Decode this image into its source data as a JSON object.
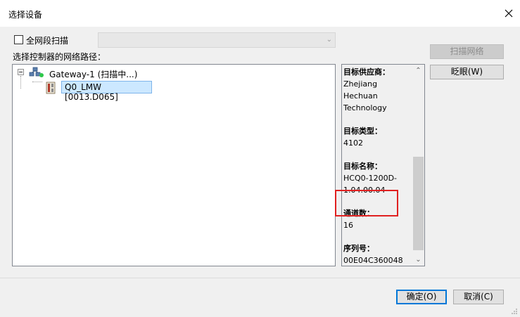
{
  "window": {
    "title": "选择设备"
  },
  "scan_all": {
    "label": "全网段扫描",
    "checked": false
  },
  "combo": {
    "value": ""
  },
  "path_label": "选择控制器的网络路径：",
  "tree": {
    "gateway": {
      "label": "Gateway-1 (扫描中...)",
      "icon": "gateway-network-icon"
    },
    "device": {
      "label": "Q0_LMW [0013.D065]",
      "icon": "plc-device-icon"
    }
  },
  "info": [
    {
      "heading": "目标供应商：",
      "value": "Zhejiang Hechuan Technology"
    },
    {
      "heading": "目标类型：",
      "value": "4102"
    },
    {
      "heading": "目标名称：",
      "value": "HCQ0-1200D-1.04.00.04"
    },
    {
      "heading": "通道数：",
      "value": "16"
    },
    {
      "heading": "序列号：",
      "value": "00E04C360048"
    }
  ],
  "buttons": {
    "scan_network": "扫描网络",
    "blink": "眨眼(W)",
    "ok": "确定(O)",
    "cancel": "取消(C)"
  },
  "colors": {
    "highlight": "#e02020",
    "selection": "#cce8ff",
    "accent": "#0078d7"
  }
}
